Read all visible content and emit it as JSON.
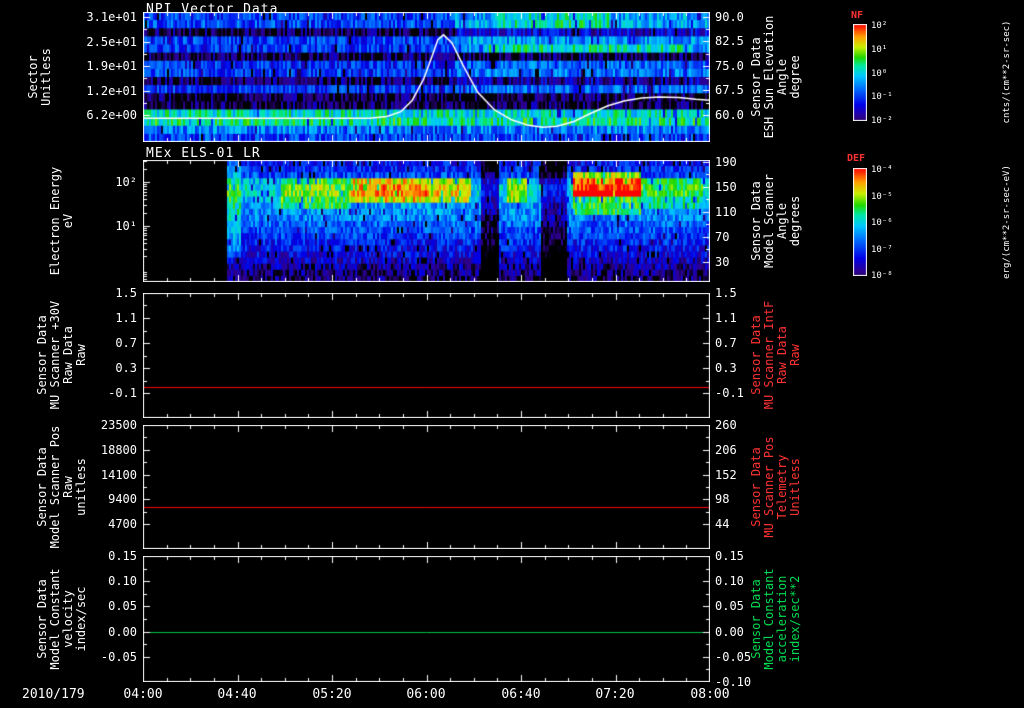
{
  "colors": {
    "background": "#000000",
    "foreground": "#ffffff",
    "red_label": "#ff3333",
    "green_label": "#00dc50",
    "line_red": "#ff0000",
    "line_green": "#00c846",
    "overlay_white": "#ffffff"
  },
  "colormap_stops": [
    {
      "p": 0.0,
      "c": "#000000"
    },
    {
      "p": 0.1,
      "c": "#2e0090"
    },
    {
      "p": 0.22,
      "c": "#0000e8"
    },
    {
      "p": 0.38,
      "c": "#0070ff"
    },
    {
      "p": 0.5,
      "c": "#00c8ff"
    },
    {
      "p": 0.6,
      "c": "#00e8a0"
    },
    {
      "p": 0.68,
      "c": "#20d800"
    },
    {
      "p": 0.78,
      "c": "#c8f000"
    },
    {
      "p": 0.88,
      "c": "#ffa000"
    },
    {
      "p": 1.0,
      "c": "#ff0000"
    }
  ],
  "x_axis": {
    "date": "2010/179",
    "start": "04:00",
    "end": "08:00",
    "ticks": [
      "04:00",
      "04:40",
      "05:20",
      "06:00",
      "06:40",
      "07:20",
      "08:00"
    ]
  },
  "colorbars": [
    {
      "label": "NF",
      "unit": "cnts/(cm**2-sr-sec)",
      "ticks": [
        "10²",
        "10¹",
        "10⁰",
        "10⁻¹",
        "10⁻²"
      ]
    },
    {
      "label": "DEF",
      "unit": "erg/(cm**2-sr-sec-eV)",
      "ticks": [
        "10⁻⁴",
        "10⁻⁵",
        "10⁻⁶",
        "10⁻⁷",
        "10⁻⁸"
      ]
    }
  ],
  "chart_data": [
    {
      "type": "heatmap",
      "title": "NPI Vector Data",
      "ylabel_left": "Sector\nUnitless",
      "ylabel_right": "Sensor Data\nESH Sun Elevation\nAngle\ndegree",
      "yaxis_left": {
        "range": [
          -0.6,
          32.3
        ],
        "ticks": [
          {
            "v": 31,
            "l": "3.1e+01"
          },
          {
            "v": 24.8,
            "l": "2.5e+01"
          },
          {
            "v": 18.6,
            "l": "1.9e+01"
          },
          {
            "v": 12.4,
            "l": "1.2e+01"
          },
          {
            "v": 6.2,
            "l": "6.2e+00"
          }
        ]
      },
      "yaxis_right": {
        "range": [
          51.7,
          91.5
        ],
        "ticks": [
          {
            "v": 90,
            "l": "90.0"
          },
          {
            "v": 82.5,
            "l": "82.5"
          },
          {
            "v": 75,
            "l": "75.0"
          },
          {
            "v": 67.5,
            "l": "67.5"
          },
          {
            "v": 60,
            "l": "60.0"
          }
        ]
      },
      "heatmap": {
        "start_frac": 0,
        "noise": 0.13,
        "row_base": [
          0.3,
          0.32,
          0.06,
          0.3,
          0.28,
          0.07,
          0.28,
          0.3,
          0.08,
          0.28,
          0.05,
          0.06,
          0.55,
          0.6,
          0.4,
          0.3
        ],
        "regions": [
          {
            "c": [
              0.55,
              1.0
            ],
            "r": [
              0,
              4
            ],
            "v": 0.13
          },
          {
            "c": [
              0.55,
              1.0
            ],
            "r": [
              6,
              9
            ],
            "v": 0.07
          },
          {
            "c": [
              0.62,
              0.82
            ],
            "r": [
              0,
              1
            ],
            "v": 0.12
          },
          {
            "c": [
              0.6,
              0.97
            ],
            "r": [
              4,
              4
            ],
            "v": 0.16
          }
        ]
      },
      "overlay_line": {
        "color": "#ffffff",
        "axis": "right",
        "x_frac": [
          0,
          0.3,
          0.4,
          0.43,
          0.455,
          0.475,
          0.495,
          0.51,
          0.52,
          0.53,
          0.545,
          0.565,
          0.59,
          0.62,
          0.65,
          0.68,
          0.705,
          0.73,
          0.76,
          0.79,
          0.82,
          0.85,
          0.88,
          0.91,
          0.945,
          0.975,
          1.0
        ],
        "y": [
          59,
          59,
          59,
          59.5,
          61,
          64.5,
          71,
          78,
          83,
          84.5,
          82,
          75,
          67,
          61.5,
          58.5,
          56.8,
          56.2,
          56.5,
          58,
          60.5,
          62.8,
          64.3,
          65.2,
          65.5,
          65.3,
          64.8,
          64.5
        ]
      }
    },
    {
      "type": "heatmap",
      "title": "MEx ELS-01 LR",
      "ylabel_left": "Electron Energy\neV",
      "ylabel_right": "Sensor Data\nModel Scanner\nAngle\ndegrees",
      "yaxis_left": {
        "scale": "log",
        "range": [
          0.52,
          316
        ],
        "ticks": [
          {
            "v": 100,
            "l": "10²"
          },
          {
            "v": 10,
            "l": "10¹"
          }
        ]
      },
      "yaxis_right": {
        "range": [
          -2,
          193
        ],
        "ticks": [
          {
            "v": 190,
            "l": "190"
          },
          {
            "v": 150,
            "l": "150"
          },
          {
            "v": 110,
            "l": "110"
          },
          {
            "v": 70,
            "l": "70"
          },
          {
            "v": 30,
            "l": "30"
          }
        ]
      },
      "heatmap": {
        "start_frac": 0.145,
        "noise": 0.12,
        "row_base": [
          0.24,
          0.27,
          0.32,
          0.46,
          0.52,
          0.52,
          0.47,
          0.44,
          0.42,
          0.4,
          0.36,
          0.33,
          0.3,
          0.27,
          0.24,
          0.21,
          0.17,
          0.13,
          0.1,
          0.07
        ],
        "regions": [
          {
            "c": [
              0.145,
              0.17
            ],
            "r": [
              0,
              15
            ],
            "v": 0.15
          },
          {
            "c": [
              0.24,
              0.365
            ],
            "r": [
              3,
              7
            ],
            "v": 0.2
          },
          {
            "c": [
              0.365,
              0.5
            ],
            "r": [
              3,
              6
            ],
            "v": 0.36
          },
          {
            "c": [
              0.5,
              0.575
            ],
            "r": [
              3,
              6
            ],
            "v": 0.3
          },
          {
            "c": [
              0.595,
              0.625
            ],
            "r": [
              0,
              19
            ],
            "v": -0.28
          },
          {
            "c": [
              0.64,
              0.675
            ],
            "r": [
              3,
              6
            ],
            "v": 0.26
          },
          {
            "c": [
              0.7,
              0.745
            ],
            "r": [
              0,
              19
            ],
            "v": -0.28
          },
          {
            "c": [
              0.755,
              0.875
            ],
            "r": [
              2,
              5
            ],
            "v": 0.45
          },
          {
            "c": [
              0.755,
              0.875
            ],
            "r": [
              5,
              8
            ],
            "v": 0.2
          },
          {
            "c": [
              0.875,
              0.985
            ],
            "r": [
              3,
              7
            ],
            "v": 0.14
          }
        ]
      }
    },
    {
      "type": "line",
      "ylabel_left": "Sensor Data\nMU Scanner +30V\nRaw Data\nRaw",
      "ylabel_right": "Sensor Data\nMU Scanner IntF\nRaw Data\nRaw",
      "yaxis_left": {
        "range": [
          -0.5,
          1.5
        ],
        "ticks": [
          {
            "v": 1.5,
            "l": "1.5"
          },
          {
            "v": 1.1,
            "l": "1.1"
          },
          {
            "v": 0.7,
            "l": "0.7"
          },
          {
            "v": 0.3,
            "l": "0.3"
          },
          {
            "v": -0.1,
            "l": "-0.1"
          }
        ]
      },
      "yaxis_right": {
        "range": [
          -0.5,
          1.5
        ],
        "ticks": [
          {
            "v": 1.5,
            "l": "1.5"
          },
          {
            "v": 1.1,
            "l": "1.1"
          },
          {
            "v": 0.7,
            "l": "0.7"
          },
          {
            "v": 0.3,
            "l": "0.3"
          },
          {
            "v": -0.1,
            "l": "-0.1"
          }
        ]
      },
      "series": {
        "color": "#ff0000",
        "value": 0.0,
        "shape": "constant"
      }
    },
    {
      "type": "line",
      "ylabel_left": "Sensor Data\nModel Scanner Pos\nRaw\nunitless",
      "ylabel_right": "Sensor Data\nMU Scanner Pos\nTelemetry\nUnitless",
      "yaxis_left": {
        "range": [
          0,
          23500
        ],
        "ticks": [
          {
            "v": 23500,
            "l": "23500"
          },
          {
            "v": 18800,
            "l": "18800"
          },
          {
            "v": 14100,
            "l": "14100"
          },
          {
            "v": 9400,
            "l": "9400"
          },
          {
            "v": 4700,
            "l": "4700"
          }
        ]
      },
      "yaxis_right": {
        "range": [
          -10,
          260
        ],
        "ticks": [
          {
            "v": 260,
            "l": "260"
          },
          {
            "v": 206,
            "l": "206"
          },
          {
            "v": 152,
            "l": "152"
          },
          {
            "v": 98,
            "l": "98"
          },
          {
            "v": 44,
            "l": "44"
          }
        ]
      },
      "series": {
        "color": "#ff0000",
        "value": 8000,
        "shape": "constant"
      }
    },
    {
      "type": "line",
      "ylabel_left": "Sensor Data\nModel Constant\nvelocity\nindex/sec",
      "ylabel_right": "Sensor Data\nModel Constant\nacceleration\nindex/sec**2",
      "yaxis_left": {
        "range": [
          -0.1,
          0.15
        ],
        "ticks": [
          {
            "v": 0.15,
            "l": "0.15"
          },
          {
            "v": 0.1,
            "l": "0.10"
          },
          {
            "v": 0.05,
            "l": "0.05"
          },
          {
            "v": 0.0,
            "l": "0.00"
          },
          {
            "v": -0.05,
            "l": "-0.05"
          }
        ]
      },
      "yaxis_right": {
        "range": [
          -0.1,
          0.15
        ],
        "ticks": [
          {
            "v": 0.15,
            "l": "0.15"
          },
          {
            "v": 0.1,
            "l": "0.10"
          },
          {
            "v": 0.05,
            "l": "0.05"
          },
          {
            "v": 0.0,
            "l": "0.00"
          },
          {
            "v": -0.05,
            "l": "-0.05"
          },
          {
            "v": -0.1,
            "l": "-0.10"
          }
        ]
      },
      "series": {
        "color": "#00c846",
        "value": 0.0,
        "shape": "constant"
      }
    }
  ]
}
